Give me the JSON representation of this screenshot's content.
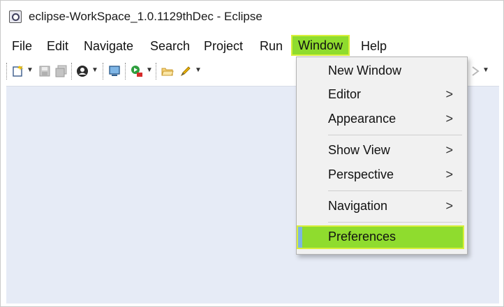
{
  "window": {
    "title": "eclipse-WorkSpace_1.0.1129thDec - Eclipse"
  },
  "menubar": {
    "items": [
      "File",
      "Edit",
      "Navigate",
      "Search",
      "Project",
      "Run",
      "Window",
      "Help"
    ],
    "active": "Window"
  },
  "toolbar": {
    "icons": [
      "new-file-icon",
      "save-icon",
      "save-all-icon",
      "profile-icon",
      "monitor-icon",
      "run-icon",
      "open-folder-icon",
      "pen-icon"
    ]
  },
  "window_menu": {
    "items": [
      {
        "label": "New Window",
        "submenu": false
      },
      {
        "label": "Editor",
        "submenu": true
      },
      {
        "label": "Appearance",
        "submenu": true
      },
      {
        "label": "Show View",
        "submenu": true
      },
      {
        "label": "Perspective",
        "submenu": true
      },
      {
        "label": "Navigation",
        "submenu": true
      },
      {
        "label": "Preferences",
        "submenu": false
      }
    ],
    "chevron": ">",
    "selected": "Preferences"
  },
  "colors": {
    "highlight": "#8fdc2e",
    "highlight_border": "#d8ef3a",
    "workarea": "#e6ebf6"
  }
}
